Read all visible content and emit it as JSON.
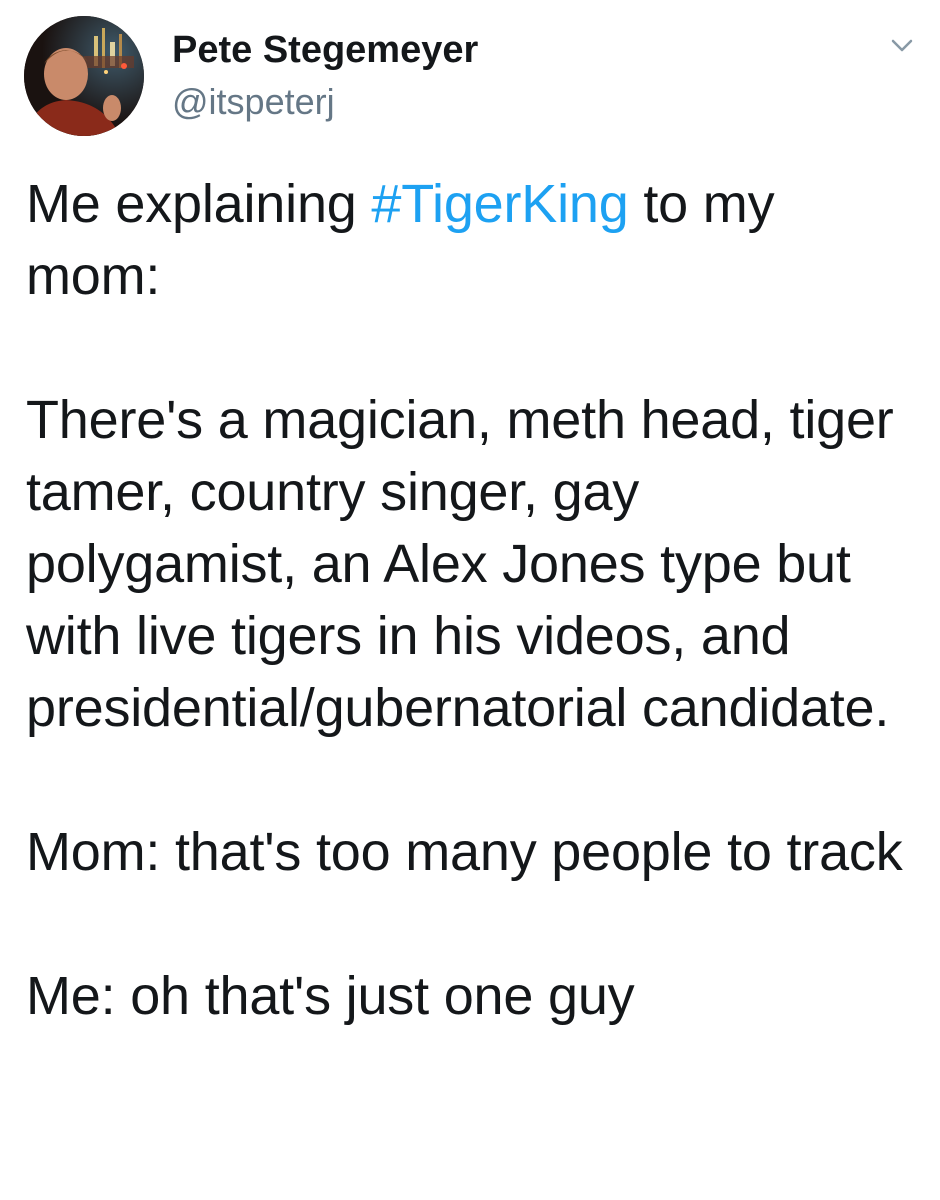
{
  "user": {
    "display_name": "Pete Stegemeyer",
    "handle": "@itspeterj"
  },
  "tweet": {
    "intro_before": "Me explaining ",
    "hashtag": "#TigerKing",
    "intro_after": " to my mom:",
    "paragraph_2": "There's a magician, meth head, tiger tamer, country singer,  gay polygamist, an Alex Jones type but with live tigers in his videos, and presidential/gubernatorial candidate.",
    "paragraph_3": "Mom:  that's too many people to track",
    "paragraph_4": "Me: oh that's just one guy"
  },
  "icons": {
    "menu": "chevron-down-icon",
    "avatar": "avatar"
  },
  "colors": {
    "text": "#14171a",
    "muted": "#657786",
    "link": "#1da1f2"
  }
}
